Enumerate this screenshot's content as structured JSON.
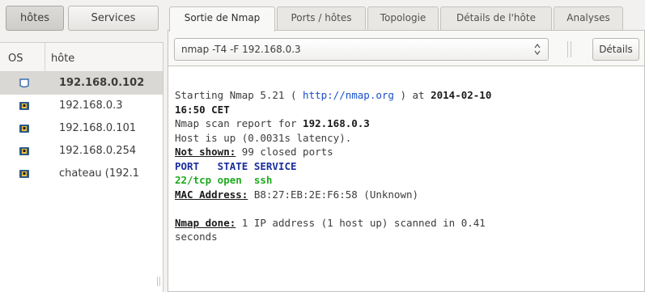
{
  "mode_tabs": {
    "hosts": "hôtes",
    "services": "Services"
  },
  "host_list": {
    "col_os": "OS",
    "col_host": "hôte",
    "rows": [
      {
        "host": "192.168.0.102",
        "icon": "os-unknown-icon",
        "selected": true
      },
      {
        "host": "192.168.0.3",
        "icon": "os-linux-icon"
      },
      {
        "host": "192.168.0.101",
        "icon": "os-linux-icon"
      },
      {
        "host": "192.168.0.254",
        "icon": "os-linux-icon"
      },
      {
        "host": "chateau (192.1",
        "icon": "os-linux-icon"
      }
    ]
  },
  "tabs": [
    {
      "label": "Sortie de Nmap",
      "active": true
    },
    {
      "label": "Ports / hôtes"
    },
    {
      "label": "Topologie"
    },
    {
      "label": "Détails de l'hôte"
    },
    {
      "label": "Analyses"
    }
  ],
  "toolbar": {
    "command": "nmap -T4 -F 192.168.0.3",
    "details_label": "Détails"
  },
  "output": {
    "l1_prefix": "Starting Nmap 5.21 ( ",
    "l1_link": "http://nmap.org",
    "l1_mid": " ) at ",
    "l1_date": "2014-02-10",
    "l2": "16:50 CET",
    "l3_prefix": "Nmap scan report for ",
    "l3_host": "192.168.0.3",
    "l4": "Host is up (0.0031s latency).",
    "l5_label": "Not shown:",
    "l5_rest": " 99 closed ports",
    "l6": "PORT   STATE SERVICE",
    "l7": "22/tcp open  ssh",
    "l8_label": "MAC Address:",
    "l8_rest": " B8:27:EB:2E:F6:58 (Unknown)",
    "l10_label": "Nmap done:",
    "l10_rest": " 1 IP address (1 host up) scanned in 0.41",
    "l11": "seconds"
  },
  "colors": {
    "link": "#1a50c8",
    "port_header": "#1a2f9e",
    "port_open": "#1faa1f",
    "selection": "#dad8d4"
  }
}
